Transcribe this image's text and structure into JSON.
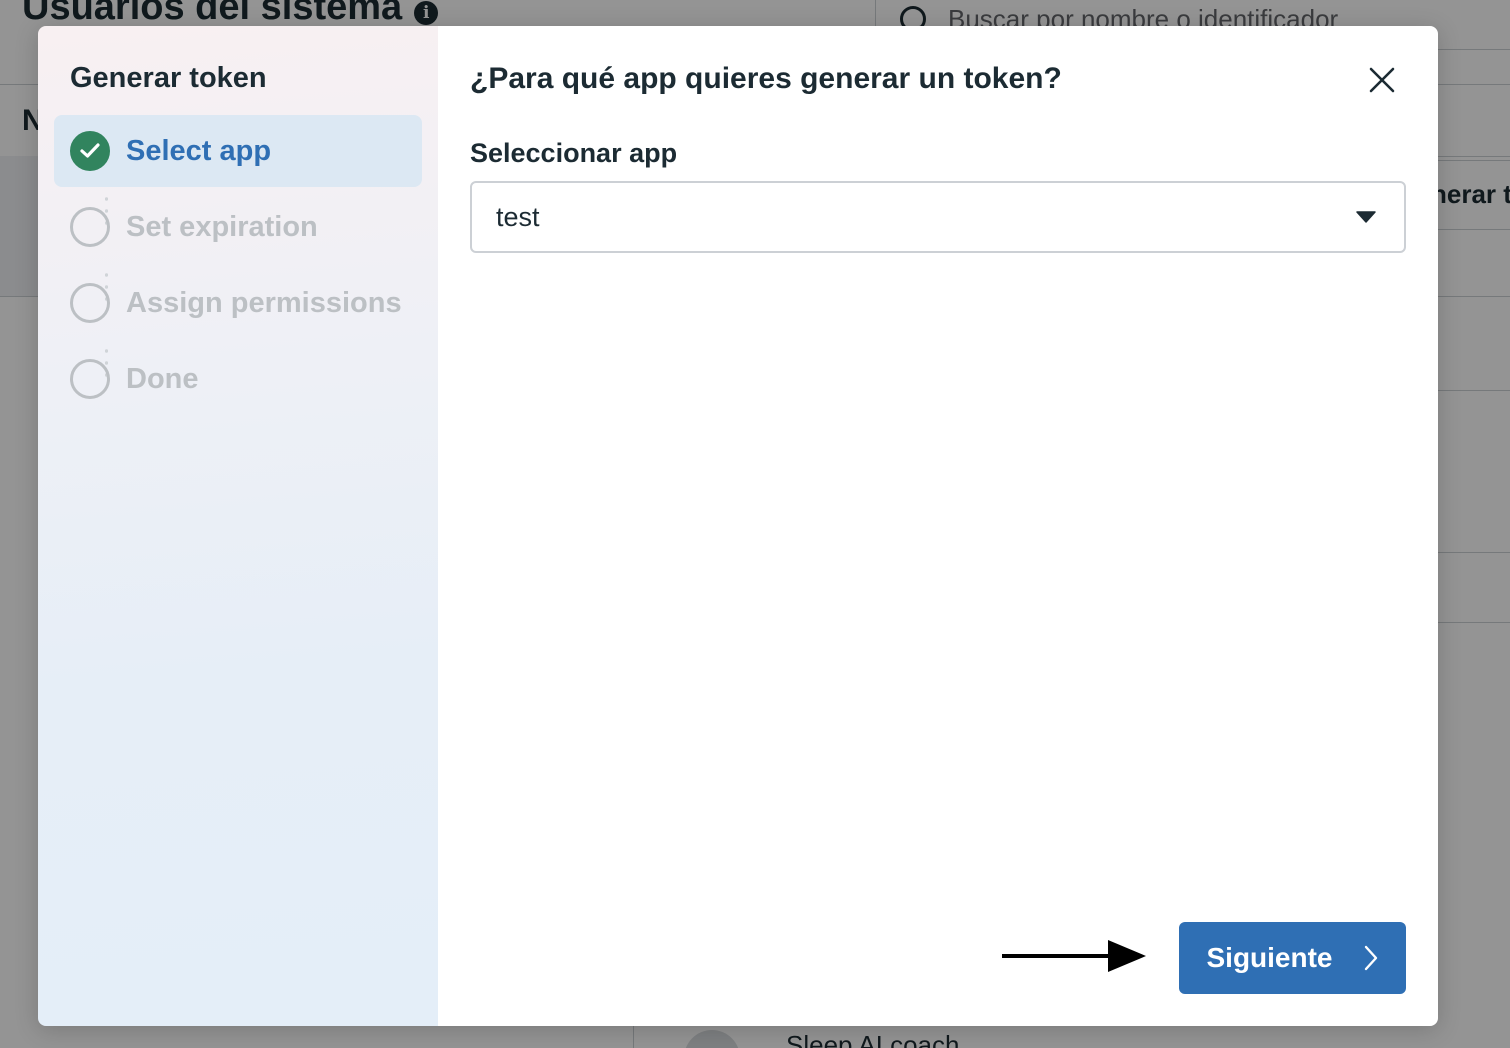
{
  "background": {
    "title": "Usuarios del sistema",
    "search_placeholder": "Buscar por nombre o identificador",
    "column_initial": "N",
    "right_button_label": "nerar t",
    "bottom_item_name": "Sleep AI coach"
  },
  "dialog": {
    "sidebar_title": "Generar token",
    "steps": [
      {
        "label": "Select app",
        "state": "completed"
      },
      {
        "label": "Set expiration",
        "state": "pending"
      },
      {
        "label": "Assign permissions",
        "state": "pending"
      },
      {
        "label": "Done",
        "state": "pending"
      }
    ],
    "heading": "¿Para qué app quieres generar un token?",
    "select_label": "Seleccionar app",
    "select_value": "test",
    "next_button_label": "Siguiente"
  },
  "icons": {
    "info": "info-icon",
    "search": "search-icon",
    "close": "close-icon",
    "check": "check-icon",
    "caret": "caret-down-icon",
    "chevron": "chevron-right-icon",
    "annotation_arrow": "arrow-right-icon"
  },
  "colors": {
    "primary": "#2f6fb4",
    "success": "#31845e",
    "text": "#1c2b33",
    "muted": "#bcc0c4",
    "active_step_bg": "#dce8f3"
  }
}
